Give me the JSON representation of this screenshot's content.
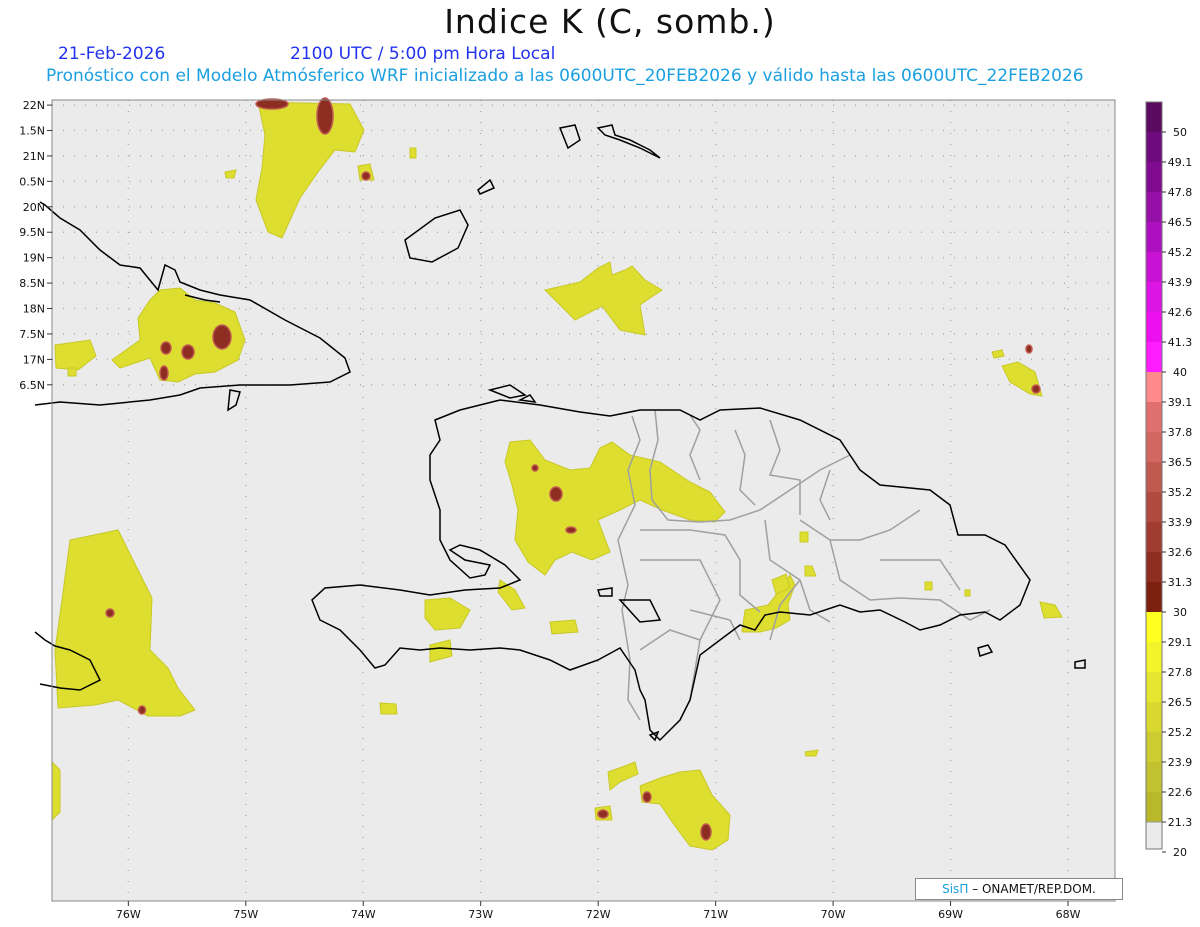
{
  "header": {
    "title": "Indice K (C, somb.)",
    "date": "21-Feb-2026",
    "time": "2100 UTC / 5:00 pm Hora Local",
    "forecast": "Pronóstico con el Modelo Atmósferico WRF inicializado a las 0600UTC_20FEB2026 y válido hasta las  0600UTC_22FEB2026"
  },
  "map": {
    "lon_range": [
      -76.65,
      -67.6
    ],
    "lat_range": [
      6.35,
      22.1
    ],
    "lat_ticks": [
      {
        "value": 22,
        "label": "22N"
      },
      {
        "value": 21.5,
        "label": "1.5N"
      },
      {
        "value": 21,
        "label": "21N"
      },
      {
        "value": 20.5,
        "label": "0.5N"
      },
      {
        "value": 20,
        "label": "20N"
      },
      {
        "value": 19.5,
        "label": "9.5N"
      },
      {
        "value": 19,
        "label": "19N"
      },
      {
        "value": 18.5,
        "label": "8.5N"
      },
      {
        "value": 18,
        "label": "18N"
      },
      {
        "value": 17.5,
        "label": "7.5N"
      },
      {
        "value": 17,
        "label": "17N"
      },
      {
        "value": 16.5,
        "label": "6.5N"
      }
    ],
    "lon_ticks": [
      {
        "value": -76,
        "label": "76W"
      },
      {
        "value": -75,
        "label": "75W"
      },
      {
        "value": -74,
        "label": "74W"
      },
      {
        "value": -73,
        "label": "73W"
      },
      {
        "value": -72,
        "label": "72W"
      },
      {
        "value": -71,
        "label": "71W"
      },
      {
        "value": -70,
        "label": "70W"
      },
      {
        "value": -69,
        "label": "69W"
      },
      {
        "value": -68,
        "label": "68W"
      }
    ],
    "background_color": "#ebebeb",
    "coast_color": "#000000",
    "province_color": "#a0a0a0"
  },
  "colorbar": {
    "labels": [
      "50",
      "49.1",
      "47.8",
      "46.5",
      "45.2",
      "43.9",
      "42.6",
      "41.3",
      "40",
      "39.1",
      "37.8",
      "36.5",
      "35.2",
      "33.9",
      "32.6",
      "31.3",
      "30",
      "29.1",
      "27.8",
      "26.5",
      "25.2",
      "23.9",
      "22.6",
      "21.3",
      "20"
    ],
    "colors": [
      "#5a0a60",
      "#6e0a7e",
      "#800a90",
      "#9610a8",
      "#ae10c0",
      "#c812d4",
      "#dc14e4",
      "#ec10ee",
      "#ff1cff",
      "#ff8a8a",
      "#e07070",
      "#d26660",
      "#c05a50",
      "#b04a40",
      "#a03c32",
      "#8e2e22",
      "#7c2010",
      "#ffff20",
      "#f4f42c",
      "#e6e630",
      "#d8d830",
      "#cccc30",
      "#c2c230",
      "#b8b828"
    ]
  },
  "credit": {
    "brand": "SisΠ",
    "text": " – ONAMET/REP.DOM."
  }
}
